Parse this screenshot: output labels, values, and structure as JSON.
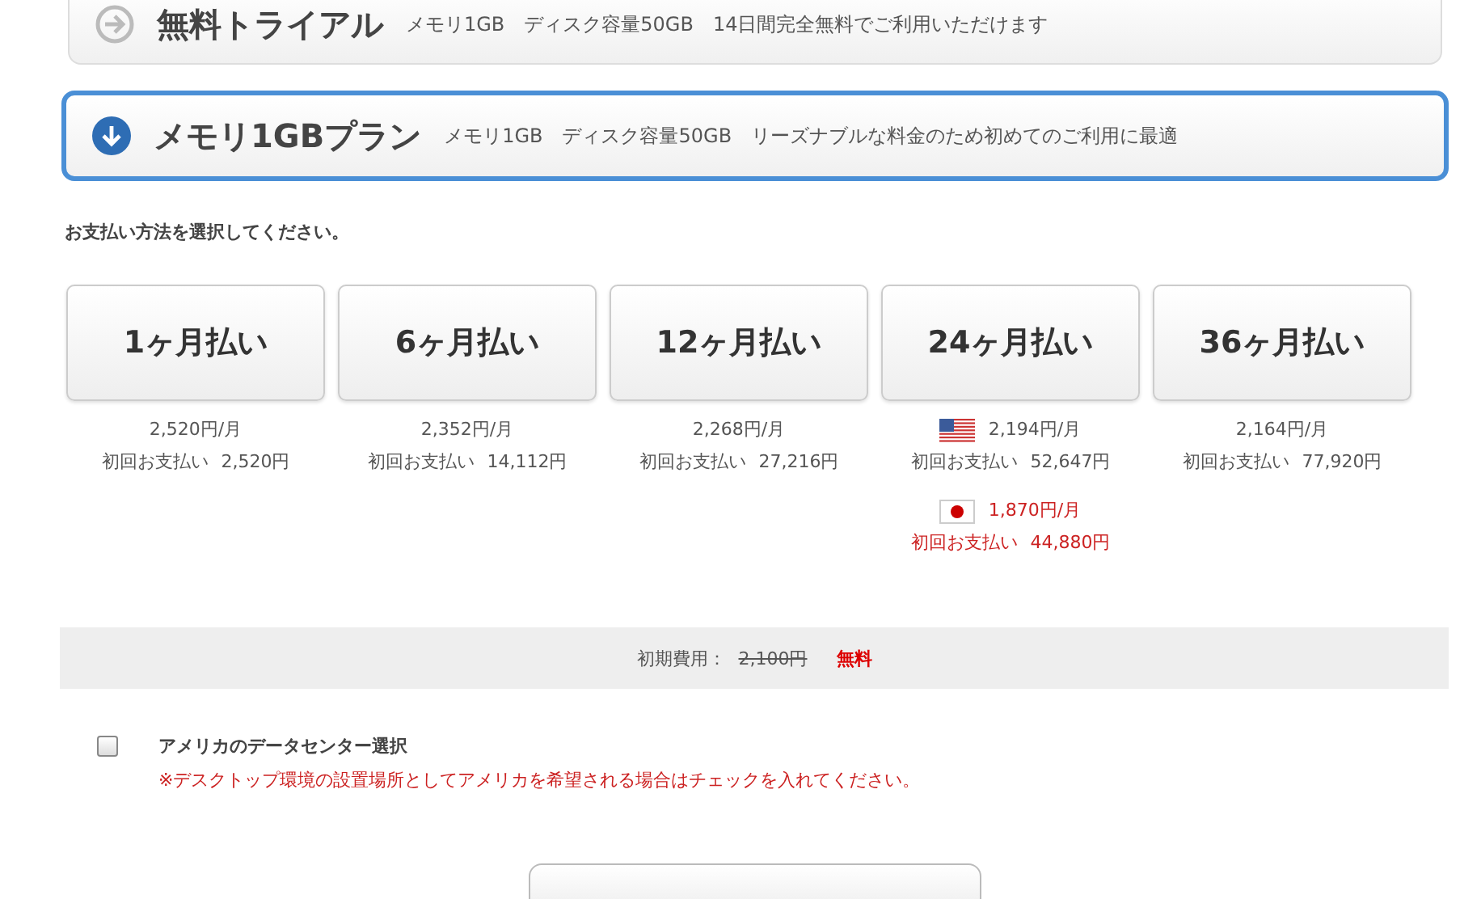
{
  "plans": [
    {
      "name": "無料トライアル",
      "description": "メモリ1GB　ディスク容量50GB　14日間完全無料でご利用いただけます",
      "selected": false
    },
    {
      "name": "メモリ1GBプラン",
      "description": "メモリ1GB　ディスク容量50GB　リーズナブルな料金のため初めてのご利用に最適",
      "selected": true
    }
  ],
  "payment_prompt": "お支払い方法を選択してください。",
  "payment_options": [
    {
      "label": "1ヶ月払い",
      "selected": false,
      "prices": [
        {
          "kind": "plain",
          "monthly": "2,520円/月",
          "first_label": "初回お支払い",
          "first_amount": "2,520円",
          "color": "#555555"
        }
      ]
    },
    {
      "label": "6ヶ月払い",
      "selected": false,
      "prices": [
        {
          "kind": "plain",
          "monthly": "2,352円/月",
          "first_label": "初回お支払い",
          "first_amount": "14,112円",
          "color": "#555555"
        }
      ]
    },
    {
      "label": "12ヶ月払い",
      "selected": false,
      "prices": [
        {
          "kind": "plain",
          "monthly": "2,268円/月",
          "first_label": "初回お支払い",
          "first_amount": "27,216円",
          "color": "#555555"
        }
      ]
    },
    {
      "label": "24ヶ月払い",
      "selected": false,
      "prices": [
        {
          "kind": "us",
          "monthly": "2,194円/月",
          "first_label": "初回お支払い",
          "first_amount": "52,647円",
          "color": "#555555"
        },
        {
          "kind": "jp",
          "monthly": "1,870円/月",
          "first_label": "初回お支払い",
          "first_amount": "44,880円",
          "color": "#cc2222"
        }
      ]
    },
    {
      "label": "36ヶ月払い",
      "selected": false,
      "prices": [
        {
          "kind": "plain",
          "monthly": "2,164円/月",
          "first_label": "初回お支払い",
          "first_amount": "77,920円",
          "color": "#555555"
        }
      ]
    }
  ],
  "initial_fee": {
    "label": "初期費用：",
    "old_price": "2,100円",
    "new_price": "無料"
  },
  "datacenter": {
    "label": "アメリカのデータセンター選択",
    "checked": false,
    "note": "※デスクトップ環境の設置場所としてアメリカを希望される場合はチェックを入れてください。"
  }
}
